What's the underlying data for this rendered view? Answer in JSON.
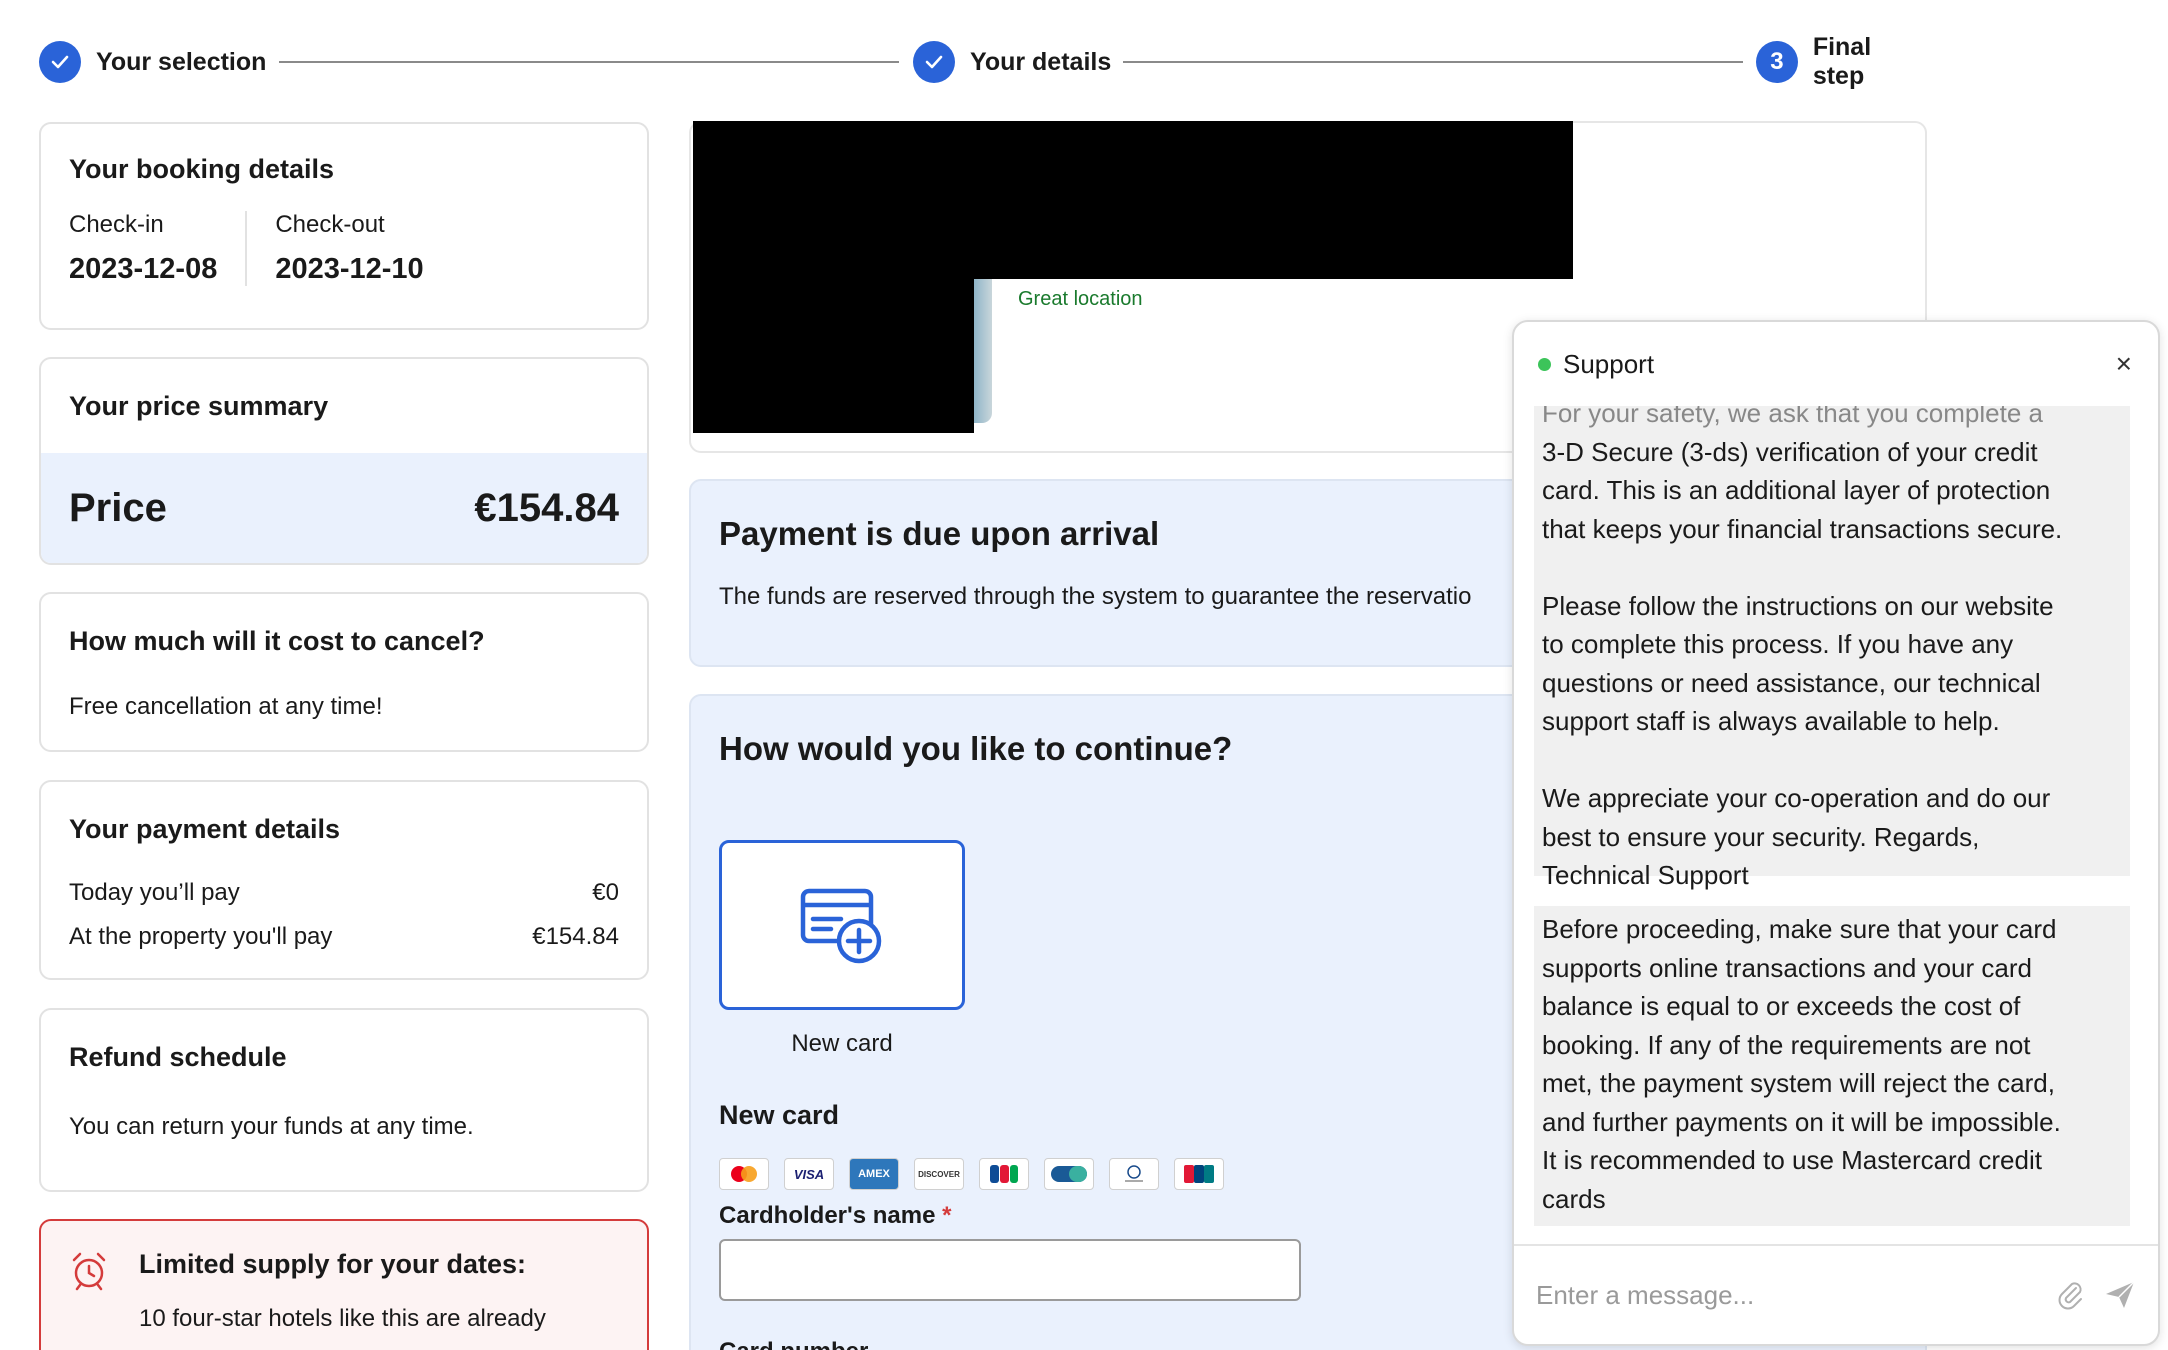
{
  "stepper": {
    "steps": [
      {
        "label": "Your selection",
        "state": "done"
      },
      {
        "label": "Your details",
        "state": "done"
      },
      {
        "label": "Final step",
        "number": "3",
        "state": "current"
      }
    ]
  },
  "booking": {
    "title": "Your booking details",
    "checkin_label": "Check-in",
    "checkin_date": "2023-12-08",
    "checkout_label": "Check-out",
    "checkout_date": "2023-12-10"
  },
  "price_summary": {
    "title": "Your price summary",
    "price_label": "Price",
    "price_value": "€154.84"
  },
  "cancel": {
    "title": "How much will it cost to cancel?",
    "text": "Free cancellation at any time!"
  },
  "payment": {
    "title": "Your payment details",
    "today_label": "Today you’ll pay",
    "today_value": "€0",
    "property_label": "At the property you'll pay",
    "property_value": "€154.84"
  },
  "refund": {
    "title": "Refund schedule",
    "text": "You can return your funds at any time."
  },
  "limited": {
    "title": "Limited supply for your dates:",
    "text": "10 four-star hotels like this are already"
  },
  "hotel": {
    "tag": "Great location"
  },
  "due": {
    "title": "Payment is due upon arrival",
    "text": "The funds are reserved through the system to guarantee the reservatio"
  },
  "continue": {
    "title": "How would you like to continue?",
    "tile_caption": "New card",
    "section_title": "New card",
    "brands": [
      "mastercard",
      "VISA",
      "AMEX",
      "DISCOVER",
      "JCB",
      "CB",
      "Diners Club",
      "UnionPay"
    ],
    "holder_label": "Cardholder's name",
    "required_mark": "*",
    "cardnum_label": "Card number"
  },
  "chat": {
    "title": "Support",
    "close": "×",
    "msg1_partial": "For your safety, we ask that you complete a",
    "msg1_lines": [
      "3-D Secure (3-ds) verification of your credit",
      "card. This is an additional layer of protection",
      "that keeps your financial transactions secure.",
      "",
      "Please follow the instructions on our website",
      "to complete this process. If you have any",
      "questions or need assistance, our technical",
      "support staff is always available to help.",
      "",
      "We appreciate your co-operation and do our",
      "best to ensure your security. Regards,",
      "Technical Support"
    ],
    "msg2_lines": [
      "Before proceeding, make sure that your card",
      "supports online transactions and your card",
      "balance is equal to or exceeds the cost of",
      "booking. If any of the requirements are not",
      "met, the payment system will reject the card,",
      "and further payments on it will be impossible.",
      "It is recommended to use Mastercard credit",
      "cards"
    ],
    "input_placeholder": "Enter a message..."
  },
  "colors": {
    "accent": "#2a63d8",
    "panel_blue": "#eaf1fd",
    "green": "#1a7a2d",
    "alert_red": "#d43b3b"
  }
}
